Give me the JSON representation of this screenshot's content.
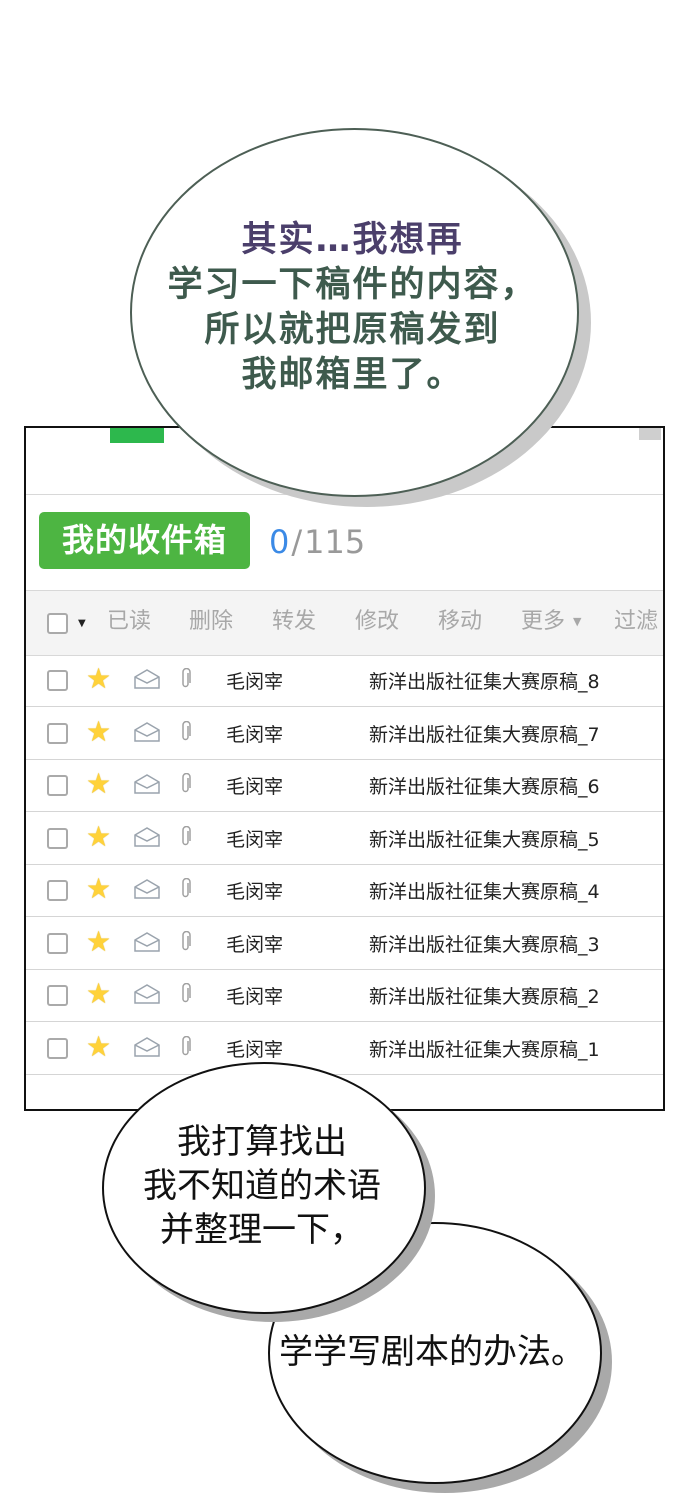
{
  "bubble_top": {
    "lines": [
      "其实…我想再",
      "学习一下稿件的内容，",
      "所以就把原稿发到",
      "我邮箱里了。"
    ]
  },
  "mailbox": {
    "folder_name": "我的收件箱",
    "unread": "0",
    "total": "115",
    "toolbar": [
      "已读",
      "删除",
      "转发",
      "修改",
      "移动",
      "更多",
      "过滤"
    ],
    "colors": {
      "accent_green": "#4db542",
      "count_blue": "#3b8ae6",
      "star": "#ffd23a"
    },
    "rows": [
      {
        "sender": "毛闵宰",
        "subject": "新洋出版社征集大赛原稿_8"
      },
      {
        "sender": "毛闵宰",
        "subject": "新洋出版社征集大赛原稿_7"
      },
      {
        "sender": "毛闵宰",
        "subject": "新洋出版社征集大赛原稿_6"
      },
      {
        "sender": "毛闵宰",
        "subject": "新洋出版社征集大赛原稿_5"
      },
      {
        "sender": "毛闵宰",
        "subject": "新洋出版社征集大赛原稿_4"
      },
      {
        "sender": "毛闵宰",
        "subject": "新洋出版社征集大赛原稿_3"
      },
      {
        "sender": "毛闵宰",
        "subject": "新洋出版社征集大赛原稿_2"
      },
      {
        "sender": "毛闵宰",
        "subject": "新洋出版社征集大赛原稿_1"
      }
    ]
  },
  "bubble_mid": {
    "lines": [
      "我打算找出",
      "我不知道的术语",
      "并整理一下，"
    ]
  },
  "bubble_bottom": {
    "line": "学学写剧本的办法。"
  },
  "icons": [
    "star-icon",
    "envelope-icon",
    "paperclip-icon",
    "dropdown-caret-icon"
  ]
}
